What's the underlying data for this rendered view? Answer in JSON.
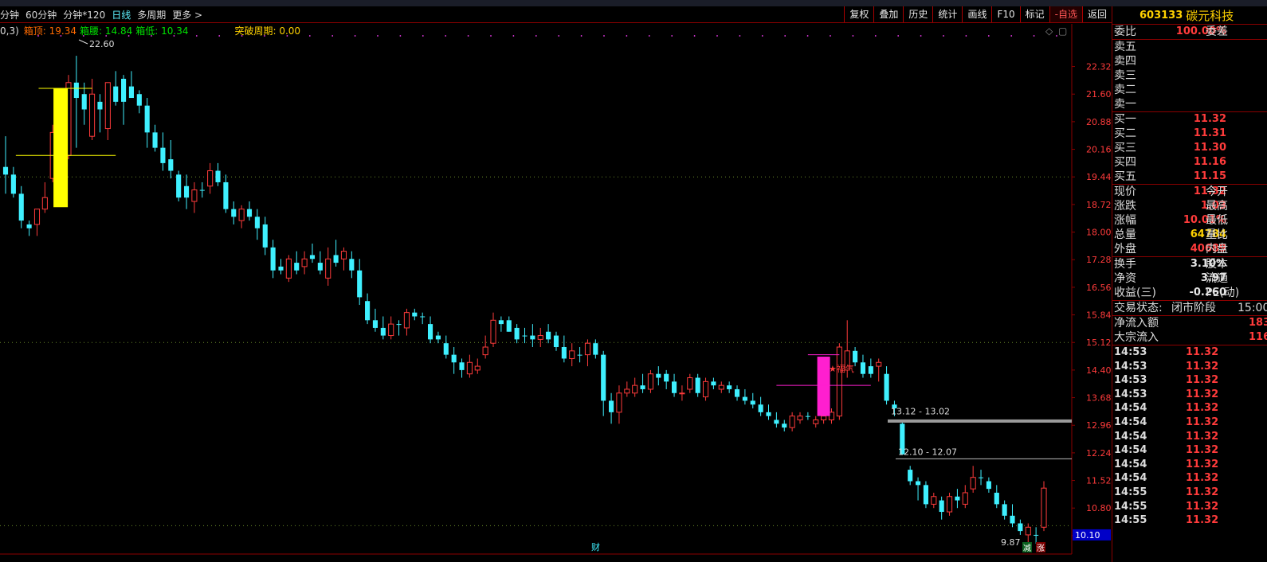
{
  "toolbar": {
    "periods": [
      "分钟",
      "60分钟",
      "分钟*120",
      "日线",
      "多周期",
      "更多 >"
    ],
    "active_period": "日线",
    "buttons": [
      "复权",
      "叠加",
      "历史",
      "统计",
      "画线",
      "F10",
      "标记",
      "-自选",
      "返回"
    ]
  },
  "indicator": {
    "prefix": "0,3)",
    "items": [
      {
        "label": "箱顶",
        "value": "19.34",
        "color": "#ff6a00"
      },
      {
        "label": "箱腰",
        "value": "14.84",
        "color": "#00e000"
      },
      {
        "label": "箱低",
        "value": "10.34",
        "color": "#00e000"
      },
      {
        "label": "突破周期",
        "value": "0.00",
        "color": "#ffd200"
      }
    ]
  },
  "chart_data": {
    "type": "candlestick",
    "y_ticks": [
      "22.32",
      "21.60",
      "20.88",
      "20.16",
      "19.44",
      "18.72",
      "18.00",
      "17.28",
      "16.56",
      "15.84",
      "15.12",
      "14.40",
      "13.68",
      "12.96",
      "12.24",
      "11.52",
      "10.80",
      "10.08"
    ],
    "ylim": [
      9.6,
      23.1
    ],
    "current_price_label": "10.10",
    "annotations": {
      "high_label": "22.60",
      "low_label": "9.87",
      "range_label_1": "13.12 - 13.02",
      "range_label_2": "12.10 - 12.07",
      "marker_text": "★福气",
      "finance_marker": "财",
      "signal_jian": "减",
      "signal_zhang": "涨"
    },
    "candles": [
      [
        19.7,
        20.5,
        19.0,
        19.5,
        "down"
      ],
      [
        19.5,
        19.7,
        18.9,
        19.0,
        "down"
      ],
      [
        19.0,
        19.2,
        18.1,
        18.3,
        "down"
      ],
      [
        18.2,
        18.3,
        17.9,
        18.1,
        "down"
      ],
      [
        18.2,
        18.6,
        17.9,
        18.6,
        "up"
      ],
      [
        18.6,
        19.3,
        18.5,
        18.9,
        "up"
      ],
      [
        19.4,
        20.8,
        19.3,
        20.6,
        "up"
      ],
      [
        20.2,
        21.2,
        20.0,
        20.6,
        "up"
      ],
      [
        20.0,
        22.1,
        19.9,
        21.9,
        "up"
      ],
      [
        21.5,
        22.6,
        20.2,
        21.9,
        "down"
      ],
      [
        21.6,
        21.9,
        20.8,
        21.2,
        "down"
      ],
      [
        20.5,
        22.0,
        20.4,
        21.6,
        "up"
      ],
      [
        21.4,
        21.6,
        20.6,
        21.2,
        "down"
      ],
      [
        20.7,
        21.9,
        20.4,
        21.9,
        "up"
      ],
      [
        21.8,
        22.2,
        21.3,
        21.4,
        "down"
      ],
      [
        21.4,
        22.1,
        20.8,
        22.0,
        "down"
      ],
      [
        21.8,
        22.2,
        21.5,
        21.5,
        "down"
      ],
      [
        21.6,
        21.7,
        21.1,
        21.3,
        "down"
      ],
      [
        21.3,
        21.5,
        20.2,
        20.6,
        "down"
      ],
      [
        20.6,
        20.8,
        20.1,
        20.2,
        "down"
      ],
      [
        20.2,
        20.6,
        19.6,
        19.8,
        "down"
      ],
      [
        19.9,
        20.4,
        19.4,
        19.6,
        "down"
      ],
      [
        19.5,
        19.6,
        18.8,
        18.9,
        "down"
      ],
      [
        18.9,
        19.5,
        18.6,
        19.2,
        "down"
      ],
      [
        18.8,
        19.3,
        18.5,
        19.1,
        "up"
      ],
      [
        19.1,
        19.3,
        18.9,
        19.1,
        "down"
      ],
      [
        19.2,
        19.8,
        19.0,
        19.6,
        "up"
      ],
      [
        19.6,
        19.8,
        19.2,
        19.3,
        "down"
      ],
      [
        19.3,
        19.5,
        18.5,
        18.6,
        "down"
      ],
      [
        18.6,
        18.8,
        18.2,
        18.4,
        "down"
      ],
      [
        18.3,
        18.7,
        18.1,
        18.6,
        "up"
      ],
      [
        18.6,
        18.8,
        18.3,
        18.4,
        "down"
      ],
      [
        18.4,
        18.6,
        17.8,
        18.1,
        "down"
      ],
      [
        18.2,
        18.4,
        17.4,
        17.6,
        "down"
      ],
      [
        17.6,
        17.8,
        16.8,
        17.0,
        "down"
      ],
      [
        17.0,
        17.3,
        16.9,
        17.1,
        "down"
      ],
      [
        16.8,
        17.4,
        16.7,
        17.3,
        "up"
      ],
      [
        17.2,
        17.5,
        16.9,
        17.0,
        "down"
      ],
      [
        17.1,
        17.5,
        16.9,
        17.3,
        "up"
      ],
      [
        17.3,
        17.7,
        17.2,
        17.4,
        "down"
      ],
      [
        17.2,
        17.5,
        16.9,
        17.0,
        "down"
      ],
      [
        16.8,
        17.6,
        16.6,
        17.3,
        "up"
      ],
      [
        17.2,
        17.8,
        17.1,
        17.4,
        "down"
      ],
      [
        17.3,
        17.6,
        17.0,
        17.5,
        "up"
      ],
      [
        17.3,
        17.5,
        16.8,
        17.0,
        "down"
      ],
      [
        17.0,
        17.3,
        16.1,
        16.3,
        "down"
      ],
      [
        16.2,
        16.4,
        15.6,
        15.7,
        "down"
      ],
      [
        15.7,
        16.0,
        15.4,
        15.5,
        "down"
      ],
      [
        15.5,
        15.8,
        15.2,
        15.3,
        "down"
      ],
      [
        15.3,
        15.8,
        15.2,
        15.6,
        "up"
      ],
      [
        15.6,
        15.7,
        15.3,
        15.6,
        "down"
      ],
      [
        15.5,
        16.0,
        15.3,
        15.9,
        "up"
      ],
      [
        15.9,
        16.0,
        15.7,
        15.8,
        "down"
      ],
      [
        15.8,
        15.9,
        15.6,
        15.8,
        "down"
      ],
      [
        15.6,
        15.8,
        15.1,
        15.2,
        "down"
      ],
      [
        15.3,
        15.4,
        15.1,
        15.2,
        "down"
      ],
      [
        15.1,
        15.3,
        14.7,
        14.8,
        "down"
      ],
      [
        14.8,
        15.0,
        14.3,
        14.6,
        "down"
      ],
      [
        14.6,
        14.7,
        14.2,
        14.4,
        "down"
      ],
      [
        14.3,
        14.8,
        14.2,
        14.6,
        "up"
      ],
      [
        14.4,
        14.7,
        14.3,
        14.5,
        "up"
      ],
      [
        14.8,
        15.3,
        14.7,
        15.0,
        "up"
      ],
      [
        15.1,
        15.9,
        15.0,
        15.7,
        "up"
      ],
      [
        15.7,
        15.8,
        15.4,
        15.6,
        "down"
      ],
      [
        15.7,
        15.8,
        15.4,
        15.4,
        "down"
      ],
      [
        15.5,
        15.6,
        15.1,
        15.2,
        "down"
      ],
      [
        15.3,
        15.5,
        15.1,
        15.3,
        "down"
      ],
      [
        15.3,
        15.6,
        15.0,
        15.2,
        "down"
      ],
      [
        15.2,
        15.5,
        15.0,
        15.3,
        "up"
      ],
      [
        15.4,
        15.6,
        15.1,
        15.2,
        "down"
      ],
      [
        15.3,
        15.4,
        14.9,
        15.0,
        "down"
      ],
      [
        15.0,
        15.3,
        14.6,
        14.7,
        "down"
      ],
      [
        14.7,
        15.1,
        14.5,
        14.9,
        "up"
      ],
      [
        14.8,
        15.0,
        14.6,
        14.8,
        "down"
      ],
      [
        14.8,
        15.2,
        14.5,
        15.1,
        "up"
      ],
      [
        15.1,
        15.2,
        14.7,
        14.8,
        "down"
      ],
      [
        14.8,
        14.9,
        13.2,
        13.6,
        "down"
      ],
      [
        13.6,
        13.8,
        13.0,
        13.3,
        "down"
      ],
      [
        13.3,
        14.0,
        13.0,
        13.8,
        "up"
      ],
      [
        13.9,
        14.1,
        13.7,
        13.8,
        "up"
      ],
      [
        13.8,
        14.2,
        13.7,
        14.0,
        "up"
      ],
      [
        14.0,
        14.3,
        13.8,
        13.9,
        "down"
      ],
      [
        13.9,
        14.4,
        13.8,
        14.3,
        "up"
      ],
      [
        14.2,
        14.5,
        14.0,
        14.3,
        "down"
      ],
      [
        14.3,
        14.4,
        13.9,
        14.1,
        "down"
      ],
      [
        14.1,
        14.3,
        13.7,
        13.8,
        "down"
      ],
      [
        13.8,
        14.0,
        13.6,
        13.8,
        "up"
      ],
      [
        13.9,
        14.3,
        13.8,
        14.2,
        "up"
      ],
      [
        14.2,
        14.3,
        13.7,
        13.8,
        "down"
      ],
      [
        13.7,
        14.2,
        13.6,
        14.1,
        "up"
      ],
      [
        14.1,
        14.2,
        13.9,
        14.0,
        "down"
      ],
      [
        13.9,
        14.1,
        13.8,
        14.0,
        "up"
      ],
      [
        14.0,
        14.1,
        13.8,
        13.9,
        "down"
      ],
      [
        13.9,
        14.0,
        13.6,
        13.7,
        "down"
      ],
      [
        13.7,
        13.9,
        13.5,
        13.6,
        "down"
      ],
      [
        13.6,
        13.8,
        13.4,
        13.5,
        "down"
      ],
      [
        13.5,
        13.7,
        13.2,
        13.3,
        "down"
      ],
      [
        13.3,
        13.5,
        13.1,
        13.2,
        "down"
      ],
      [
        13.1,
        13.3,
        12.9,
        13.0,
        "down"
      ],
      [
        13.0,
        13.1,
        12.8,
        12.9,
        "down"
      ],
      [
        12.9,
        13.3,
        12.8,
        13.2,
        "up"
      ],
      [
        13.1,
        13.3,
        13.0,
        13.2,
        "up"
      ],
      [
        13.2,
        13.3,
        13.1,
        13.2,
        "down"
      ],
      [
        13.0,
        13.2,
        12.9,
        13.1,
        "up"
      ],
      [
        13.1,
        13.3,
        13.0,
        13.2,
        "up"
      ],
      [
        13.1,
        13.4,
        13.0,
        13.3,
        "up"
      ],
      [
        13.2,
        15.1,
        13.1,
        15.0,
        "up"
      ],
      [
        14.4,
        15.7,
        14.2,
        14.9,
        "up"
      ],
      [
        14.9,
        15.0,
        14.5,
        14.6,
        "down"
      ],
      [
        14.6,
        14.8,
        14.2,
        14.3,
        "down"
      ],
      [
        14.5,
        14.7,
        14.2,
        14.3,
        "down"
      ],
      [
        14.5,
        14.7,
        14.1,
        14.6,
        "up"
      ],
      [
        14.3,
        14.5,
        13.5,
        13.6,
        "down"
      ],
      [
        13.5,
        13.6,
        13.2,
        13.4,
        "down"
      ],
      [
        13.0,
        13.1,
        12.2,
        12.2,
        "down"
      ],
      [
        11.8,
        11.9,
        11.4,
        11.5,
        "down"
      ],
      [
        11.5,
        11.6,
        11.0,
        11.4,
        "down"
      ],
      [
        11.4,
        11.5,
        10.8,
        10.9,
        "down"
      ],
      [
        10.9,
        11.2,
        10.8,
        11.1,
        "up"
      ],
      [
        11.0,
        11.1,
        10.5,
        10.7,
        "down"
      ],
      [
        10.7,
        11.2,
        10.6,
        11.1,
        "up"
      ],
      [
        11.1,
        11.3,
        10.8,
        11.0,
        "down"
      ],
      [
        10.9,
        11.4,
        10.8,
        11.2,
        "up"
      ],
      [
        11.3,
        11.9,
        11.2,
        11.6,
        "up"
      ],
      [
        11.6,
        11.8,
        11.4,
        11.6,
        "down"
      ],
      [
        11.5,
        11.6,
        11.2,
        11.3,
        "down"
      ],
      [
        11.2,
        11.4,
        10.8,
        10.9,
        "down"
      ],
      [
        10.9,
        11.0,
        10.5,
        10.6,
        "down"
      ],
      [
        10.6,
        10.9,
        10.3,
        10.4,
        "down"
      ],
      [
        10.4,
        10.5,
        10.1,
        10.2,
        "down"
      ],
      [
        10.1,
        10.4,
        9.9,
        10.3,
        "up"
      ],
      [
        10.1,
        10.3,
        9.87,
        10.1,
        "down"
      ],
      [
        10.3,
        11.5,
        10.2,
        11.32,
        "up"
      ]
    ]
  },
  "panel": {
    "code": "603133",
    "name": "碳元科技",
    "weibi": {
      "label": "委比",
      "value": "100.00%",
      "label2": "委差"
    },
    "sell": [
      {
        "label": "卖五",
        "price": ""
      },
      {
        "label": "卖四",
        "price": ""
      },
      {
        "label": "卖三",
        "price": ""
      },
      {
        "label": "卖二",
        "price": ""
      },
      {
        "label": "卖一",
        "price": ""
      }
    ],
    "buy": [
      {
        "label": "买一",
        "price": "11.32"
      },
      {
        "label": "买二",
        "price": "11.31"
      },
      {
        "label": "买三",
        "price": "11.30"
      },
      {
        "label": "买四",
        "price": "11.16"
      },
      {
        "label": "买五",
        "price": "11.15"
      }
    ],
    "stats": [
      {
        "label": "现价",
        "value": "11.32",
        "label2": "今开",
        "color": "#ff3b3b"
      },
      {
        "label": "涨跌",
        "value": "1.03",
        "label2": "最高",
        "color": "#ff3b3b"
      },
      {
        "label": "涨幅",
        "value": "10.01%",
        "label2": "最低",
        "color": "#ff3b3b"
      },
      {
        "label": "总量",
        "value": "64784",
        "label2": "量比",
        "color": "#ffd200"
      },
      {
        "label": "外盘",
        "value": "40689",
        "label2": "内盘",
        "color": "#ff3b3b"
      }
    ],
    "stats2": [
      {
        "label": "换手",
        "value": "3.10%",
        "label2": "股本",
        "color": "#e6e6e6"
      },
      {
        "label": "净资",
        "value": "3.97",
        "label2": "流通",
        "color": "#e6e6e6"
      },
      {
        "label": "收益(三)",
        "value": "-0.260",
        "label2": "PE(动)",
        "color": "#e6e6e6"
      }
    ],
    "trade_status": {
      "label": "交易状态:",
      "value": "闭市阶段",
      "time": "15:00"
    },
    "flows": [
      {
        "label": "净流入额",
        "value": "183"
      },
      {
        "label": "大宗流入",
        "value": "116"
      }
    ],
    "ticks": [
      {
        "time": "14:53",
        "price": "11.32"
      },
      {
        "time": "14:53",
        "price": "11.32"
      },
      {
        "time": "14:53",
        "price": "11.32"
      },
      {
        "time": "14:53",
        "price": "11.32"
      },
      {
        "time": "14:54",
        "price": "11.32"
      },
      {
        "time": "14:54",
        "price": "11.32"
      },
      {
        "time": "14:54",
        "price": "11.32"
      },
      {
        "time": "14:54",
        "price": "11.32"
      },
      {
        "time": "14:54",
        "price": "11.32"
      },
      {
        "time": "14:54",
        "price": "11.32"
      },
      {
        "time": "14:55",
        "price": "11.32"
      },
      {
        "time": "14:55",
        "price": "11.32"
      },
      {
        "time": "14:55",
        "price": "11.32"
      }
    ]
  }
}
